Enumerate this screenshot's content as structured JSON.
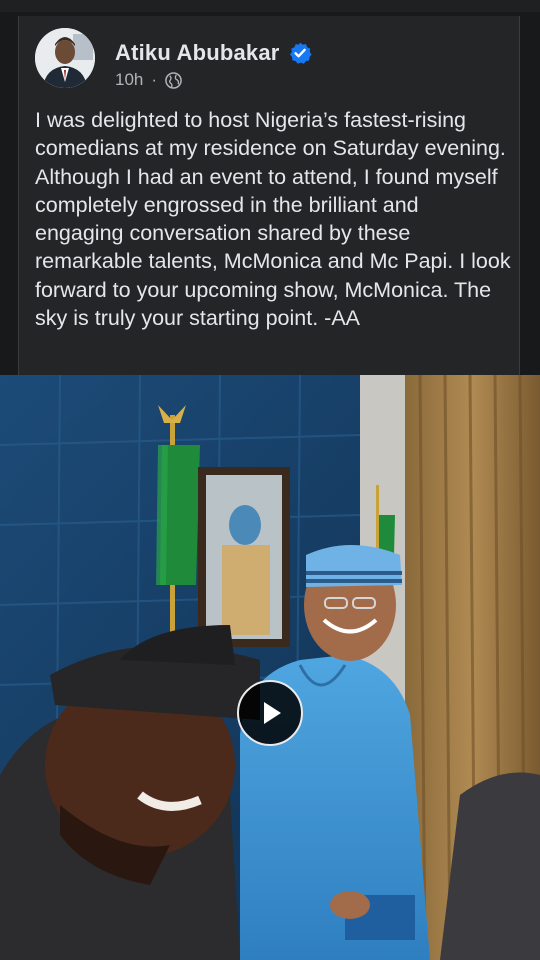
{
  "post": {
    "author": "Atiku Abubakar",
    "time": "10h",
    "separator": "·",
    "privacy_icon": "globe-icon",
    "verified_icon": "verified-badge-icon",
    "text": "I was delighted to host Nigeria’s fastest-rising comedians at my residence on Saturday evening. Although I had an event to attend, I found myself completely engrossed in the brilliant and engaging conversation shared by these remarkable talents, McMonica and Mc Papi. I look forward to your upcoming show, McMonica. The sky is truly your starting point. -AA"
  },
  "media": {
    "type": "video",
    "play_icon": "play-icon"
  },
  "colors": {
    "background": "#18191a",
    "card": "#242526",
    "text_primary": "#e4e6eb",
    "text_secondary": "#b0b3b8",
    "verified_blue": "#1877f2",
    "play_bg": "#000000"
  }
}
